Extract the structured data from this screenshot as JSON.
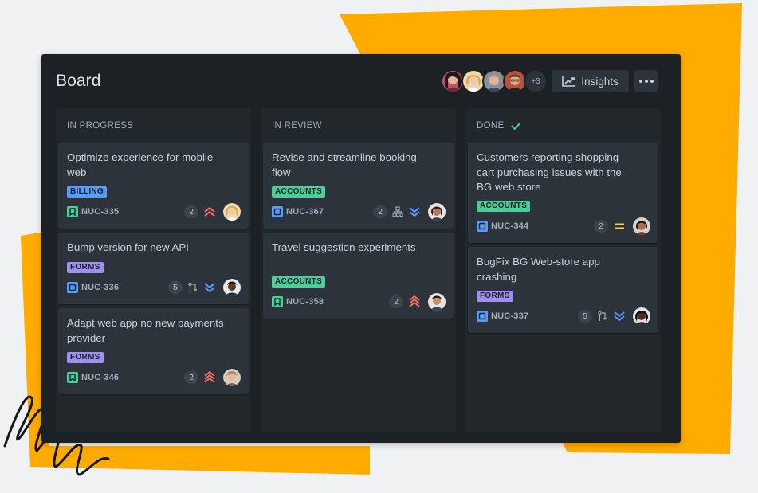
{
  "board": {
    "title": "Board",
    "avatars_more": "+3",
    "insights_label": "Insights"
  },
  "columns": [
    {
      "title": "IN PROGRESS",
      "cards": [
        {
          "title": "Optimize experience for mobile web",
          "label": "BILLING",
          "key": "NUC-335",
          "count": "2",
          "type": "story",
          "priority": "highest"
        },
        {
          "title": "Bump version for new API",
          "label": "FORMS",
          "key": "NUC-336",
          "count": "5",
          "type": "task",
          "priority": "lowest"
        },
        {
          "title": "Adapt web app no new payments provider",
          "label": "FORMS",
          "key": "NUC-346",
          "count": "2",
          "type": "story",
          "priority": "highest"
        }
      ]
    },
    {
      "title": "IN REVIEW",
      "cards": [
        {
          "title": "Revise and streamline booking flow",
          "label": "ACCOUNTS",
          "key": "NUC-367",
          "count": "2",
          "type": "task",
          "priority": "lowest"
        },
        {
          "title": "Travel suggestion experiments",
          "label": "ACCOUNTS",
          "key": "NUC-358",
          "count": "2",
          "type": "story",
          "priority": "highest"
        }
      ]
    },
    {
      "title": "DONE",
      "cards": [
        {
          "title": "Customers reporting shopping cart purchasing issues with the BG web store",
          "label": "ACCOUNTS",
          "key": "NUC-344",
          "count": "2",
          "type": "task",
          "priority": "medium"
        },
        {
          "title": "BugFix BG Web-store app crashing",
          "label": "FORMS",
          "key": "NUC-337",
          "count": "5",
          "type": "task",
          "priority": "lowest"
        }
      ]
    }
  ],
  "colors": {
    "accent_orange": "#ffab00",
    "board_bg": "#1d2125",
    "story_green": "#4bce97",
    "task_blue": "#579dff",
    "priority_high": "#f87462",
    "priority_low": "#579dff",
    "priority_medium": "#f5cd47"
  }
}
